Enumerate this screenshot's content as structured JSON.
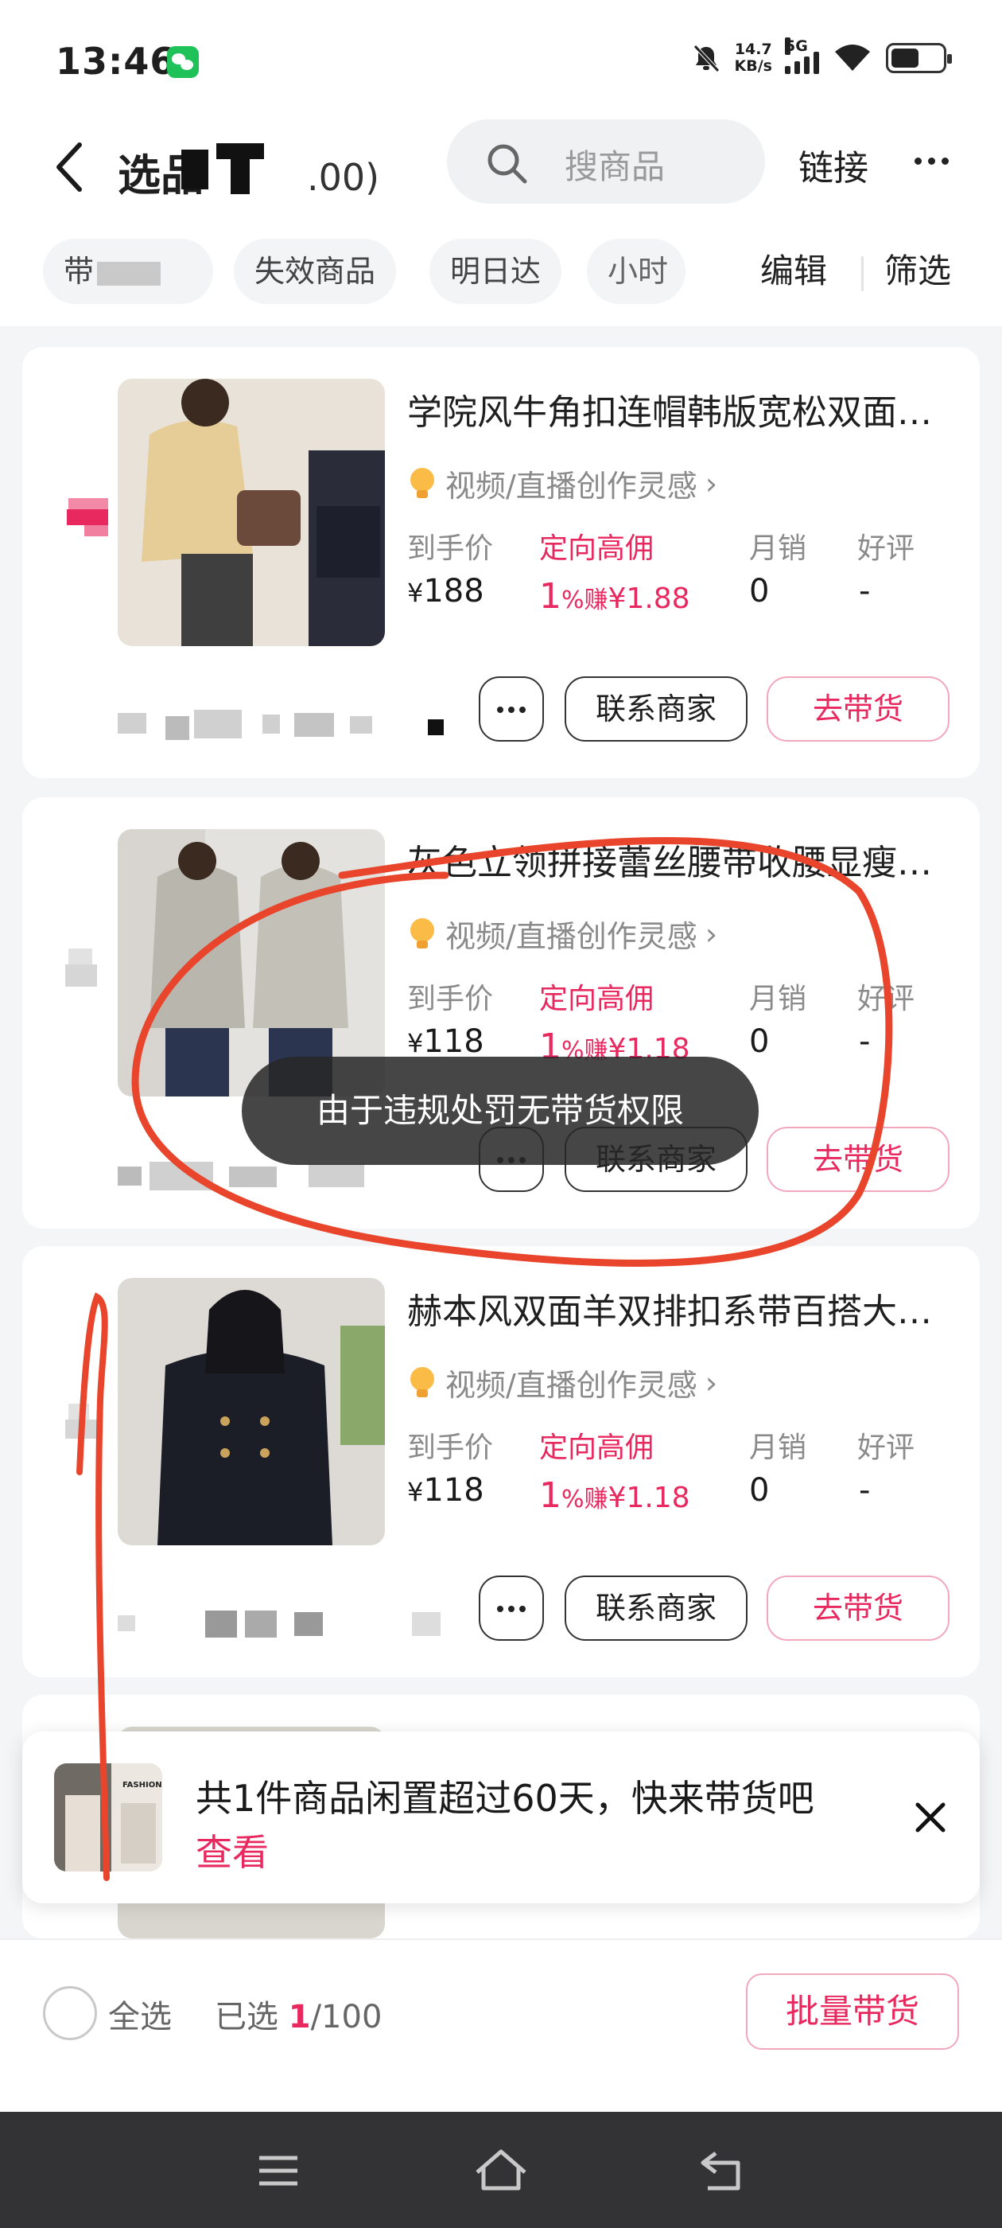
{
  "status_bar": {
    "time": "13:46",
    "network_speed_value": "14.7",
    "network_speed_unit": "KB/s",
    "signal_label": "5G",
    "icons": [
      "wechat-icon",
      "bell-muted-icon",
      "signal-icon",
      "wifi-icon",
      "battery-icon"
    ]
  },
  "header": {
    "title": "选品",
    "title_count_suffix": ".00)",
    "search_placeholder": "搜商品",
    "link_label": "链接",
    "more_icon": "more-dots-icon"
  },
  "filters": {
    "chips": [
      "带",
      "失效商品",
      "明日达",
      "小时"
    ],
    "edit_label": "编辑",
    "filter_label": "筛选"
  },
  "labels": {
    "price_label": "到手价",
    "commission_label": "定向高佣",
    "monthly_sales_label": "月销",
    "rating_label": "好评",
    "inspiration": "视频/直播创作灵感",
    "contact_button": "联系商家",
    "sell_button": "去带货"
  },
  "products": [
    {
      "title": "学院风牛角扣连帽韩版宽松双面羊绒大衣",
      "price_symbol": "¥",
      "price": "188",
      "commission_rate": "1",
      "commission_pct": "%赚",
      "commission_earn": "¥1.88",
      "monthly_sales": "0",
      "rating": "-"
    },
    {
      "title": "灰色立领拼接蕾丝腰带收腰显瘦毛呢外套",
      "price_symbol": "¥",
      "price": "118",
      "commission_rate": "1",
      "commission_pct": "%赚",
      "commission_earn": "¥1.18",
      "monthly_sales": "0",
      "rating": "-"
    },
    {
      "title": "赫本风双面羊双排扣系带百搭大衣外套",
      "price_symbol": "¥",
      "price": "118",
      "commission_rate": "1",
      "commission_pct": "%赚",
      "commission_earn": "¥1.18",
      "monthly_sales": "0",
      "rating": "-"
    }
  ],
  "toast": {
    "message": "由于违规处罚无带货权限"
  },
  "banner": {
    "message": "共1件商品闲置超过60天，快来带货吧",
    "link": "查看",
    "thumb_text": "FASHION"
  },
  "bottom_bar": {
    "select_all": "全选",
    "selected_prefix": "已选 ",
    "selected_count": "1",
    "selected_total": "/100",
    "batch_button": "批量带货"
  },
  "colors": {
    "accent_pink": "#e8295f",
    "annotation_red": "#e8452c",
    "toast_bg": "#2a2a2a",
    "nav_bar": "#333335"
  }
}
